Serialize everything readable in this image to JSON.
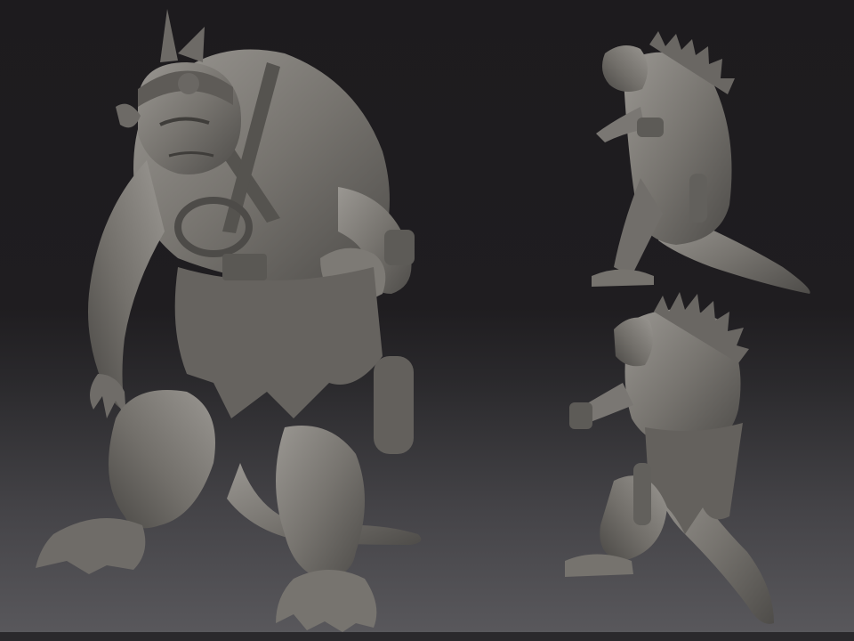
{
  "scene": {
    "views": [
      "front-three-quarter",
      "side-profile",
      "back-three-quarter"
    ]
  },
  "colors": {
    "background_top": "#1d1b1e",
    "background_bottom": "#5a595d",
    "clay": "#7a7773",
    "clay_shadow": "#4a4845",
    "clay_highlight": "#a3a09b"
  }
}
